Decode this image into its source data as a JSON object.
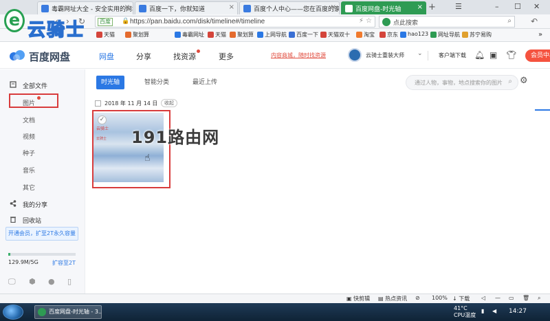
{
  "browser": {
    "tabs": [
      {
        "title": "毒霸网址大全 - 安全实用的网址"
      },
      {
        "title": "百度一下，你就知道"
      },
      {
        "title": "百度个人中心——您在百度的家"
      },
      {
        "title": "百度网盘-时光轴",
        "active": true
      }
    ],
    "address": {
      "badge": "百度",
      "url": "https://pan.baidu.com/disk/timeline#/timeline"
    },
    "search": {
      "placeholder": "点此搜索"
    },
    "bookmarks": [
      "天猫",
      "聚划算",
      "毒霸网址",
      "天猫",
      "聚划算",
      "上网导航",
      "百度一下",
      "天猫双十",
      "淘宝",
      "京东",
      "hao123",
      "网址导航",
      "苏宁易购"
    ],
    "site_logo_text": "云骑士"
  },
  "header": {
    "app_name": "百度网盘",
    "nav": [
      {
        "label": "网盘",
        "active": true
      },
      {
        "label": "分享"
      },
      {
        "label": "找资源",
        "dot": true
      },
      {
        "label": "更多"
      }
    ],
    "promo": "内容商城，随时找资源",
    "username": "云骑士重装大师",
    "client_download": "客户端下载",
    "vip_button": "会员中心"
  },
  "sidebar": {
    "items": [
      {
        "label": "全部文件",
        "level": "main"
      },
      {
        "label": "图片",
        "level": "sub"
      },
      {
        "label": "文档",
        "level": "sub"
      },
      {
        "label": "视频",
        "level": "sub"
      },
      {
        "label": "种子",
        "level": "sub"
      },
      {
        "label": "音乐",
        "level": "sub"
      },
      {
        "label": "其它",
        "level": "sub"
      },
      {
        "label": "我的分享",
        "level": "main"
      },
      {
        "label": "回收站",
        "level": "main"
      }
    ],
    "vip_upgrade": "开通会员，扩至2T永久容量",
    "quota": {
      "used_text": "129.9M/5G",
      "used_fraction": 0.03,
      "expand": "扩容至2T"
    }
  },
  "main": {
    "tabs": [
      {
        "label": "时光轴",
        "active": true
      },
      {
        "label": "智能分类"
      },
      {
        "label": "最近上传"
      }
    ],
    "search_placeholder": "通过人物，事物，地点搜索你的图片",
    "date": "2018 年 11 月 14 日",
    "collapse": "收起",
    "thumbnail": {
      "line1": "云骑士",
      "line2": "云骑士"
    },
    "watermark": "191路由网"
  },
  "statusbar": [
    "快剪辑",
    "热点资讯",
    "100%",
    "下载"
  ],
  "taskbar": {
    "app": "百度网盘-时光轴 - 3...",
    "temp": "41°C",
    "temp_label": "CPU温度",
    "time": "14:27"
  }
}
